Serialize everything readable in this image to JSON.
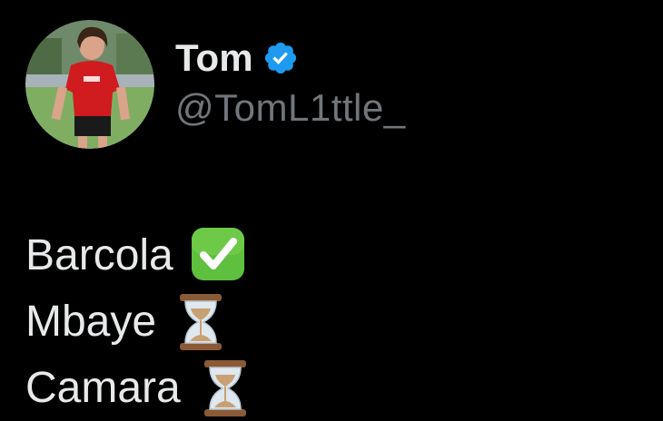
{
  "user": {
    "display_name": "Tom",
    "handle": "@TomL1ttle_",
    "verified": true,
    "verified_icon": "verified-badge-icon",
    "avatar_icon": "profile-photo"
  },
  "tweet": {
    "lines": [
      {
        "text": "Barcola",
        "emoji": "check-mark-button-icon",
        "emoji_char": "✅"
      },
      {
        "text": "Mbaye",
        "emoji": "hourglass-icon",
        "emoji_char": "⏳"
      },
      {
        "text": "Camara",
        "emoji": "hourglass-icon",
        "emoji_char": "⏳"
      }
    ]
  },
  "colors": {
    "background": "#000000",
    "text": "#e7e9ea",
    "secondary_text": "#71767b",
    "verified_blue": "#1d9bf0",
    "check_green": "#5fbf3f"
  }
}
